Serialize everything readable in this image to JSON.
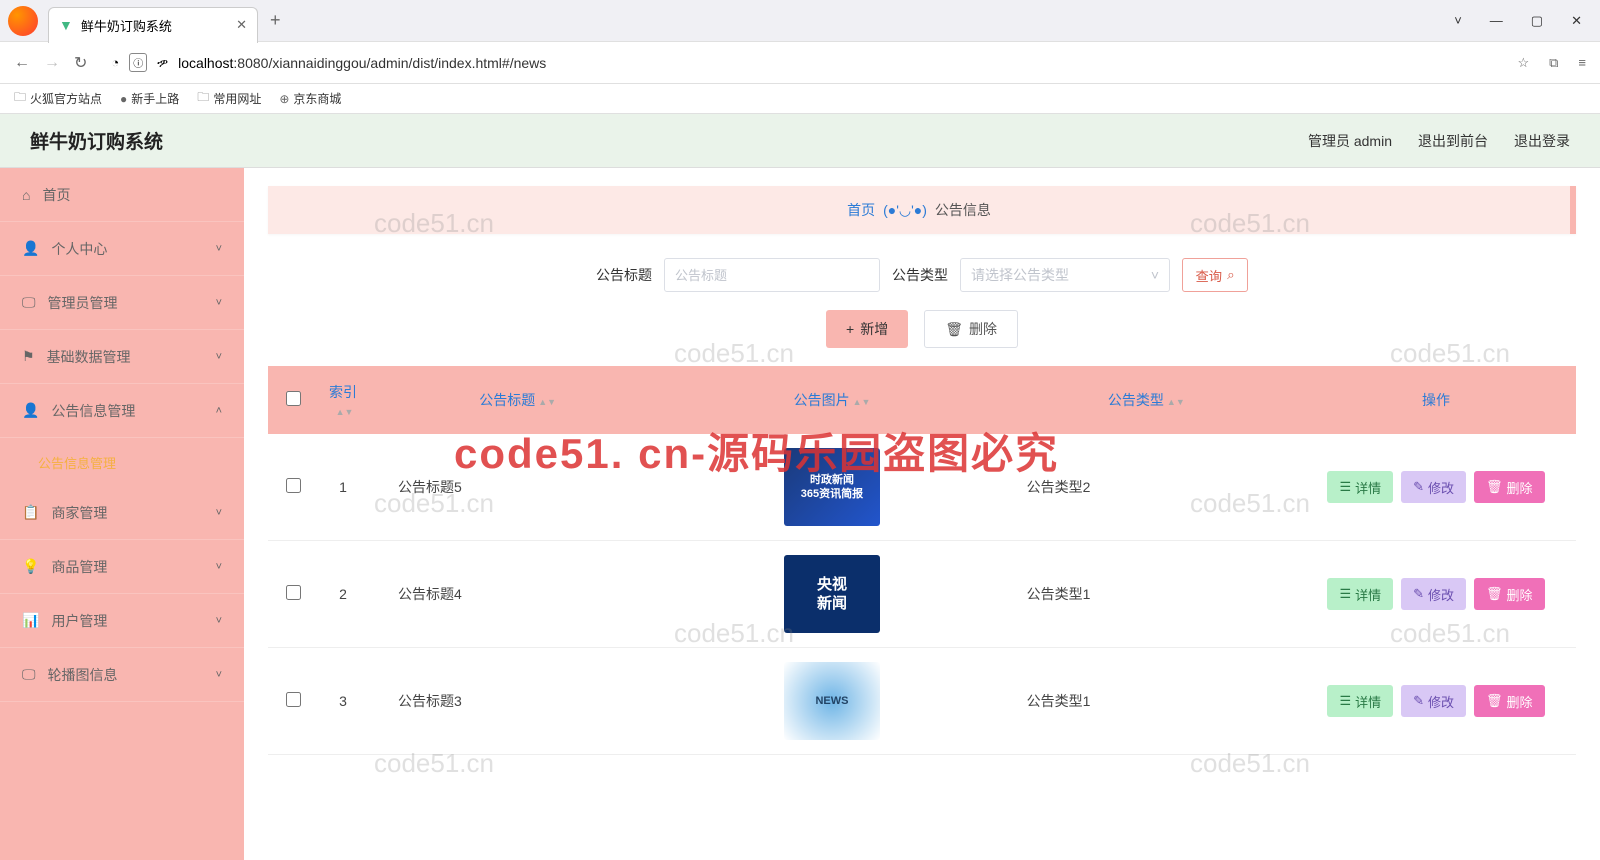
{
  "browser": {
    "tab_title": "鲜牛奶订购系统",
    "url_host": "localhost",
    "url_path": ":8080/xiannaidinggou/admin/dist/index.html#/news",
    "bookmarks": [
      "火狐官方站点",
      "新手上路",
      "常用网址",
      "京东商城"
    ]
  },
  "header": {
    "app_title": "鲜牛奶订购系统",
    "admin_label": "管理员 admin",
    "front_label": "退出到前台",
    "logout_label": "退出登录"
  },
  "sidebar": {
    "items": [
      {
        "label": "首页",
        "icon": "home",
        "sub": false
      },
      {
        "label": "个人中心",
        "icon": "user",
        "sub": true
      },
      {
        "label": "管理员管理",
        "icon": "monitor",
        "sub": true
      },
      {
        "label": "基础数据管理",
        "icon": "flag",
        "sub": true
      },
      {
        "label": "公告信息管理",
        "icon": "user",
        "sub": true,
        "expanded": true,
        "child": "公告信息管理"
      },
      {
        "label": "商家管理",
        "icon": "clipboard",
        "sub": true
      },
      {
        "label": "商品管理",
        "icon": "bulb",
        "sub": true
      },
      {
        "label": "用户管理",
        "icon": "bars",
        "sub": true
      },
      {
        "label": "轮播图信息",
        "icon": "screen",
        "sub": true
      }
    ]
  },
  "breadcrumb": {
    "home": "首页",
    "face": "(●'◡'●)",
    "current": "公告信息"
  },
  "search": {
    "title_label": "公告标题",
    "title_placeholder": "公告标题",
    "type_label": "公告类型",
    "type_placeholder": "请选择公告类型",
    "query_btn": "查询"
  },
  "actions": {
    "add": "新增",
    "delete": "删除"
  },
  "table": {
    "headers": {
      "index": "索引",
      "title": "公告标题",
      "image": "公告图片",
      "type": "公告类型",
      "ops": "操作"
    },
    "row_buttons": {
      "detail": "详情",
      "edit": "修改",
      "delete": "删除"
    },
    "rows": [
      {
        "idx": "1",
        "title": "公告标题5",
        "type": "公告类型2",
        "thumb": "时政新闻\n365资讯简报",
        "tcls": "t1"
      },
      {
        "idx": "2",
        "title": "公告标题4",
        "type": "公告类型1",
        "thumb": "央视\n新闻",
        "tcls": "t2"
      },
      {
        "idx": "3",
        "title": "公告标题3",
        "type": "公告类型1",
        "thumb": "NEWS",
        "tcls": "t3"
      }
    ]
  },
  "watermarks": {
    "grey": "code51.cn",
    "red": "code51. cn-源码乐园盗图必究"
  }
}
